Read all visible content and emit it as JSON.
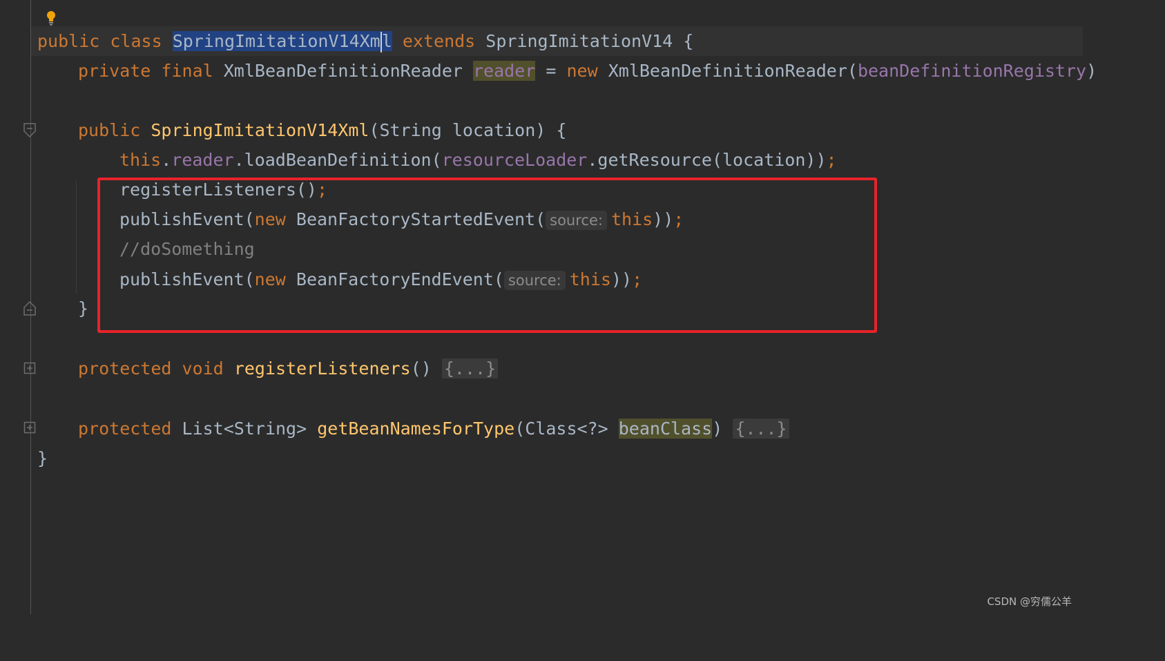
{
  "editor": {
    "line1": {
      "public": "public",
      "class": "class",
      "classname": "SpringImitationV14Xm",
      "classname_tail": "l",
      "extends": "extends",
      "super": "SpringImitationV14",
      "open": "{"
    },
    "line2": {
      "private": "private",
      "final": "final",
      "type": "XmlBeanDefinitionReader",
      "field": "reader",
      "assign": "=",
      "new": "new",
      "ctor": "XmlBeanDefinitionReader(",
      "arg": "beanDefinitionRegistry",
      "close": ")"
    },
    "line3": {
      "public": "public",
      "ctor": "SpringImitationV14Xml",
      "params": "(String location) {"
    },
    "line4": {
      "this": "this",
      "dot1": ".",
      "field": "reader",
      "call": ".loadBeanDefinition(",
      "loader": "resourceLoader",
      "rest": ".getResource(location))",
      "semi": ";"
    },
    "line5": {
      "call": "registerListeners()",
      "semi": ";"
    },
    "line6": {
      "call": "publishEvent(",
      "new": "new",
      "type": "BeanFactoryStartedEvent(",
      "hint": "source:",
      "this": "this",
      "close": "))",
      "semi": ";"
    },
    "line7": {
      "comment": "//doSomething"
    },
    "line8": {
      "call": "publishEvent(",
      "new": "new",
      "type": "BeanFactoryEndEvent(",
      "hint": "source:",
      "this": "this",
      "close": "))",
      "semi": ";"
    },
    "line9": {
      "close": "}"
    },
    "line10": {
      "protected": "protected",
      "void": "void",
      "method": "registerListeners",
      "parens": "()",
      "fold": "{...}"
    },
    "line11": {
      "protected": "protected",
      "ret": "List<String>",
      "method": "getBeanNamesForType",
      "params_open": "(Class<?>",
      "param": "beanClass",
      "params_close": ")",
      "fold": "{...}"
    },
    "line12": {
      "close": "}"
    }
  },
  "icons": {
    "bulb": "intention-bulb-icon",
    "fold_open": "fold-open-icon",
    "fold_close": "fold-close-icon",
    "fold_plus": "fold-expand-icon"
  },
  "colors": {
    "background": "#2b2b2b",
    "keyword": "#cc7832",
    "function": "#ffc66d",
    "field": "#9876aa",
    "text": "#a9b7c6",
    "comment": "#808080",
    "selection": "#214283",
    "callout": "#e8232a"
  },
  "watermark": "CSDN @穷儒公羊"
}
